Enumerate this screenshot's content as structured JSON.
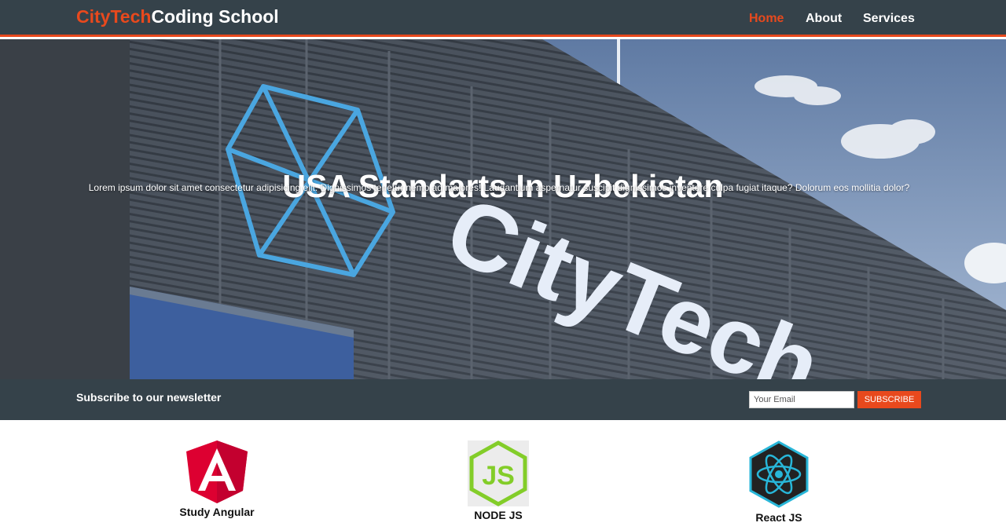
{
  "header": {
    "logo_highlight": "CityTech",
    "logo_rest": "Coding School",
    "nav": [
      {
        "label": "Home",
        "current": true
      },
      {
        "label": "About",
        "current": false
      },
      {
        "label": "Services",
        "current": false
      }
    ]
  },
  "showcase": {
    "title": "USA Standarts In Uzbekistan",
    "text": "Lorem ipsum dolor sit amet consectetur adipisicing elit. Dignissimos tenetur nemo ad maiores! Laudantium aspernatur suscipit dignissimos inventore culpa fugiat itaque? Dolorum eos mollitia dolor?",
    "background_sign_text": "CityTech"
  },
  "newsletter": {
    "heading": "Subscribe to our newsletter",
    "email_placeholder": "Your Email",
    "button_label": "SUBSCRIBE"
  },
  "boxes": [
    {
      "label": "Study Angular",
      "icon": "angular-logo-icon"
    },
    {
      "label": "NODE JS",
      "icon": "nodejs-logo-icon"
    },
    {
      "label": "React JS",
      "icon": "react-logo-icon"
    }
  ],
  "colors": {
    "accent": "#e8491d",
    "dark": "#35424a"
  }
}
